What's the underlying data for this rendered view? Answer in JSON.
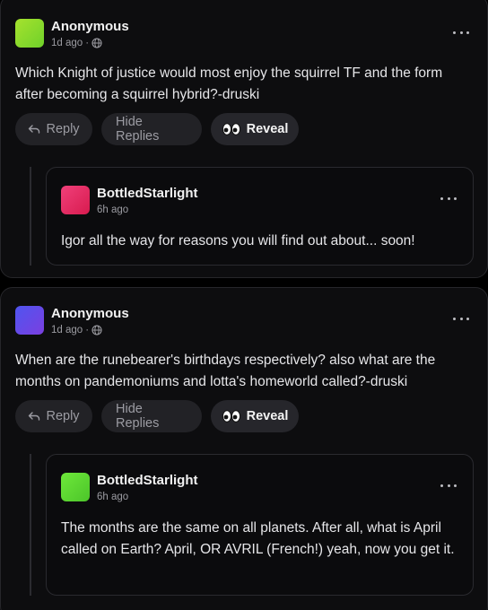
{
  "posts": [
    {
      "author": "Anonymous",
      "time": "1d ago",
      "separator": "·",
      "avatar_color_start": "#a6e22e",
      "avatar_color_end": "#6fd12a",
      "text": "Which Knight of justice would most enjoy the squirrel TF and the form after becoming a squirrel hybrid?-druski",
      "actions": {
        "reply": "Reply",
        "hide_replies": "Hide Replies",
        "reveal": "Reveal"
      },
      "reply": {
        "author": "BottledStarlight",
        "time": "6h ago",
        "avatar_color_start": "#f0407a",
        "avatar_color_end": "#d81b4f",
        "text": "Igor all the way for reasons you will find out about... soon!"
      }
    },
    {
      "author": "Anonymous",
      "time": "1d ago",
      "separator": "·",
      "avatar_color_start": "#4f55f0",
      "avatar_color_end": "#7b3fe0",
      "text": "When are the runebearer's birthdays respectively? also what are the months on pandemoniums and lotta's homeworld called?-druski",
      "actions": {
        "reply": "Reply",
        "hide_replies": "Hide Replies",
        "reveal": "Reveal"
      },
      "reply": {
        "author": "BottledStarlight",
        "time": "6h ago",
        "avatar_color_start": "#6ee83a",
        "avatar_color_end": "#4cc52a",
        "text": "The months are the same on all planets. After all, what is April called on Earth? April, OR AVRIL (French!) yeah, now you get it."
      }
    }
  ]
}
